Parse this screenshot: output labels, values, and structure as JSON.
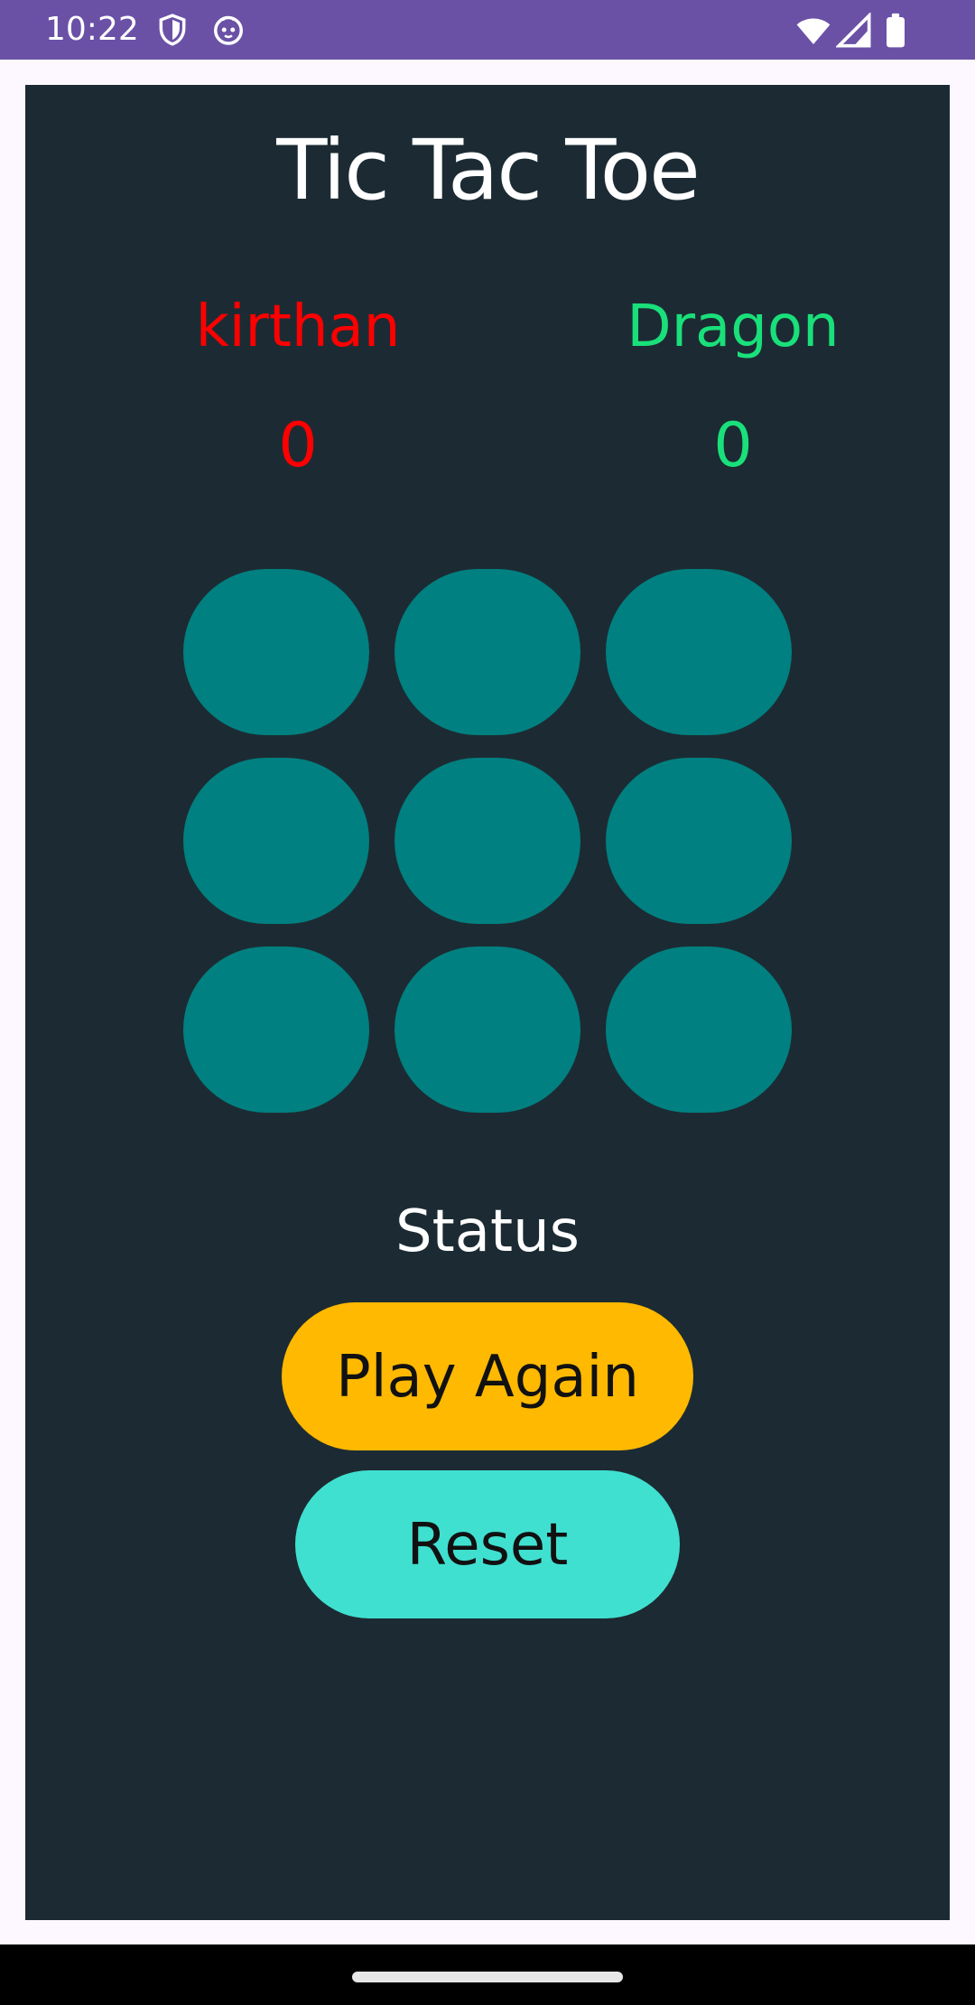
{
  "status_bar": {
    "time": "10:22",
    "icons": [
      "shield-icon",
      "cat-face-icon",
      "wifi-icon",
      "signal-icon",
      "battery-icon"
    ],
    "background": "#6a51a6"
  },
  "game": {
    "title": "Tic Tac Toe",
    "players": [
      {
        "name": "kirthan",
        "score": "0",
        "color": "#ff0000"
      },
      {
        "name": "Dragon",
        "score": "0",
        "color": "#19e07a"
      }
    ],
    "board": {
      "cells": [
        "",
        "",
        "",
        "",
        "",
        "",
        "",
        "",
        ""
      ],
      "cell_color": "#008080"
    },
    "status": "Status",
    "buttons": {
      "play_again": "Play Again",
      "reset": "Reset"
    },
    "colors": {
      "background": "#1c2b33",
      "play_again": "#ffb900",
      "reset": "#40e0d0"
    }
  },
  "nav_bar": {
    "handle": "home-gesture-handle"
  }
}
